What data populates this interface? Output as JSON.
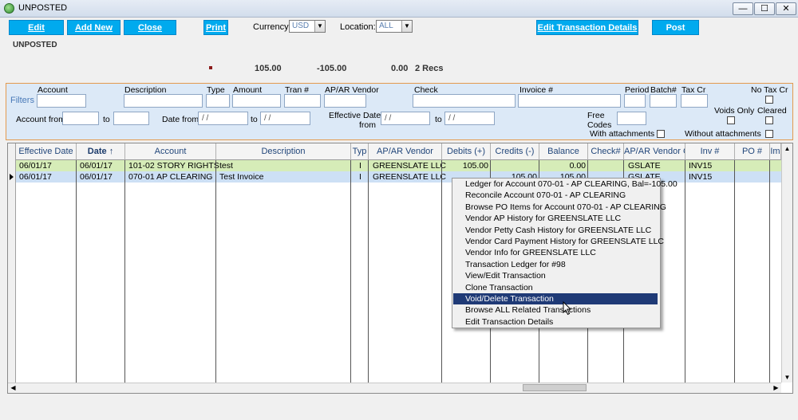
{
  "window": {
    "title": "UNPOSTED",
    "controls": {
      "minimize": "—",
      "maximize": "☐",
      "close": "✕"
    }
  },
  "toolbar": {
    "edit": "Edit",
    "add_new": "Add New",
    "close": "Close",
    "print": "Print",
    "currency_label": "Currency",
    "currency_value": "USD",
    "location_label": "Location:",
    "location_value": "ALL",
    "edit_details": "Edit Transaction Details",
    "post": "Post"
  },
  "section_label": "UNPOSTED",
  "summary": {
    "debits": "105.00",
    "credits": "-105.00",
    "balance": "0.00",
    "records": "2 Recs"
  },
  "filters": {
    "title": "Filters",
    "account": "Account",
    "description": "Description",
    "type": "Type",
    "amount": "Amount",
    "tran": "Tran #",
    "vendor": "AP/AR Vendor",
    "check": "Check",
    "invoice": "Invoice #",
    "period": "Period",
    "batch": "Batch#",
    "tax_cr": "Tax Cr",
    "no_tax_cr": "No Tax Cr",
    "account_from": "Account from",
    "to": "to",
    "date_from": "Date from",
    "date_placeholder": "/ /",
    "eff_date_from_1": "Effective Date",
    "eff_date_from_2": "from",
    "free_codes_1": "Free",
    "free_codes_2": "Codes",
    "voids_only": "Voids Only",
    "cleared": "Cleared",
    "with_attachments": "With attachments",
    "without_attachments": "Without attachments"
  },
  "grid": {
    "columns": [
      "Effective Date",
      "Date",
      "Account",
      "Description",
      "Typ",
      "AP/AR Vendor",
      "Debits (+)",
      "Credits (-)",
      "Balance",
      "Check#",
      "AP/AR Vendor C",
      "Inv #",
      "PO #",
      "Im"
    ],
    "sort_arrow": "↑",
    "rows": [
      {
        "eff_date": "06/01/17",
        "date": "06/01/17",
        "account": "101-02  STORY RIGHTS",
        "description": "test",
        "typ": "I",
        "vendor": "GREENSLATE LLC",
        "debits": "105.00",
        "credits": "",
        "balance": "0.00",
        "check": "",
        "vendor_code": "GSLATE",
        "inv": "INV15",
        "po": ""
      },
      {
        "eff_date": "06/01/17",
        "date": "06/01/17",
        "account": "070-01  AP CLEARING",
        "description": "Test Invoice",
        "typ": "I",
        "vendor": "GREENSLATE LLC",
        "debits": "",
        "credits": "105.00",
        "balance": "105.00",
        "check": "",
        "vendor_code": "GSLATE",
        "inv": "INV15",
        "po": ""
      }
    ]
  },
  "context_menu": {
    "items": [
      "Ledger for Account 070-01 - AP CLEARING,  Bal=-105.00",
      "Reconcile Account 070-01 - AP CLEARING",
      "Browse PO Items for Account 070-01 - AP CLEARING",
      "Vendor AP History for GREENSLATE LLC",
      "Vendor Petty Cash History for GREENSLATE LLC",
      "Vendor Card Payment History for GREENSLATE LLC",
      "Vendor Info for GREENSLATE LLC",
      "Transaction Ledger for #98",
      "View/Edit Transaction",
      "Clone Transaction",
      "Void/Delete Transaction",
      "Browse ALL Related Transactions",
      "Edit Transaction Details"
    ],
    "highlighted_index": 10
  }
}
